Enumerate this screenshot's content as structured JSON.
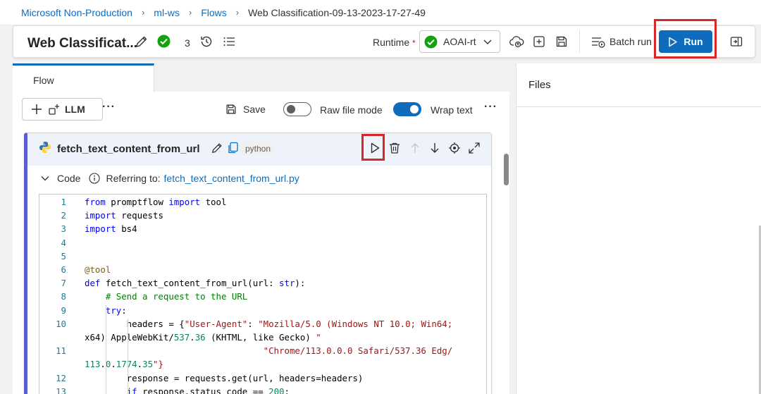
{
  "breadcrumb": {
    "workspace_root": "Microsoft Non-Production",
    "workspace": "ml-ws",
    "section": "Flows",
    "current": "Web Classification-09-13-2023-17-27-49"
  },
  "toolbar": {
    "flow_title": "Web Classificat...",
    "status_count": "3",
    "runtime_label": "Runtime",
    "runtime_required": "*",
    "runtime_value": "AOAI-rt",
    "batch_run_label": "Batch run",
    "run_label": "Run"
  },
  "tabs": {
    "flow": "Flow"
  },
  "editor_toolbar": {
    "llm_label": "LLM",
    "save_label": "Save",
    "raw_file_mode_label": "Raw file mode",
    "raw_file_mode_on": false,
    "wrap_text_label": "Wrap text",
    "wrap_text_on": true
  },
  "node": {
    "name": "fetch_text_content_from_url",
    "language": "python",
    "code_label": "Code",
    "referring_label": "Referring to:",
    "referring_file": "fetch_text_content_from_url.py"
  },
  "code_lines": [
    {
      "n": "1",
      "t": "from promptflow import tool"
    },
    {
      "n": "2",
      "t": "import requests"
    },
    {
      "n": "3",
      "t": "import bs4"
    },
    {
      "n": "4",
      "t": ""
    },
    {
      "n": "5",
      "t": ""
    },
    {
      "n": "6",
      "t": "@tool"
    },
    {
      "n": "7",
      "t": "def fetch_text_content_from_url(url: str):"
    },
    {
      "n": "8",
      "t": "    # Send a request to the URL"
    },
    {
      "n": "9",
      "t": "    try:"
    },
    {
      "n": "10",
      "t": "        headers = {\"User-Agent\": \"Mozilla/5.0 (Windows NT 10.0; Win64;"
    },
    {
      "n": "",
      "t": "x64) AppleWebKit/537.36 (KHTML, like Gecko) \""
    },
    {
      "n": "11",
      "t": "                                  \"Chrome/113.0.0.0 Safari/537.36 Edg/"
    },
    {
      "n": "",
      "t": "113.0.1774.35\"}"
    },
    {
      "n": "12",
      "t": "        response = requests.get(url, headers=headers)"
    },
    {
      "n": "13",
      "t": "        if response.status_code == 200:"
    }
  ],
  "files_panel": {
    "title": "Files"
  },
  "colors": {
    "accent": "#0f6cbd",
    "highlight": "#d62828",
    "success": "#13a10e"
  }
}
